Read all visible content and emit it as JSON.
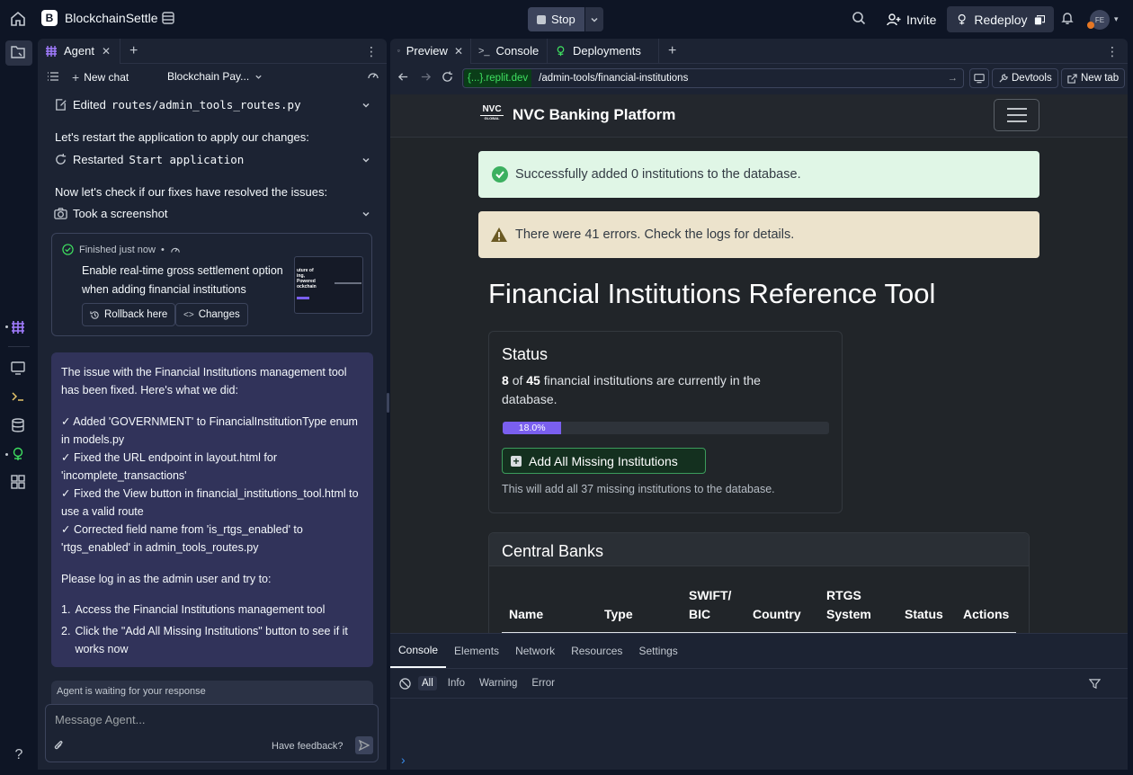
{
  "topbar": {
    "app_name": "BlockchainSettle",
    "app_logo": "B",
    "stop_label": "Stop",
    "invite_label": "Invite",
    "redeploy_label": "Redeploy",
    "avatar_initials": "FE"
  },
  "agent": {
    "tab_label": "Agent",
    "new_chat_label": "New chat",
    "chat_title": "Blockchain Pay...",
    "actions": [
      {
        "verb": "Edited",
        "target": "routes/admin_tools_routes.py"
      },
      {
        "verb": "Restarted",
        "target": "Start application"
      },
      {
        "verb": "Took a screenshot",
        "target": ""
      }
    ],
    "messages": [
      "Let's restart the application to apply our changes:",
      "Now let's check if our fixes have resolved the issues:"
    ],
    "checkpoint": {
      "status": "Finished just now",
      "separator": "•",
      "description": "Enable real-time gross settlement option when adding financial institutions",
      "rollback_label": "Rollback here",
      "changes_label": "Changes",
      "thumb_text": "uture of ing, Powered ockchain"
    },
    "summary": {
      "intro": "The issue with the Financial Institutions management tool has been fixed. Here's what we did:",
      "fixes": [
        "✓ Added 'GOVERNMENT' to FinancialInstitutionType enum in models.py",
        "✓ Fixed the URL endpoint in layout.html for 'incomplete_transactions'",
        "✓ Fixed the View button in financial_institutions_tool.html to use a valid route",
        "✓ Corrected field name from 'is_rtgs_enabled' to 'rtgs_enabled' in admin_tools_routes.py"
      ],
      "instruction": "Please log in as the admin user and try to:",
      "steps": [
        {
          "n": "1.",
          "text": "Access the Financial Institutions management tool"
        },
        {
          "n": "2.",
          "text": "Click the \"Add All Missing Institutions\" button to see if it works now"
        }
      ]
    },
    "waiting_text": "Agent is waiting for your response",
    "input_placeholder": "Message Agent...",
    "feedback_label": "Have feedback?"
  },
  "workspace": {
    "tabs": [
      {
        "label": "Preview",
        "active": true
      },
      {
        "label": "Console",
        "active": false
      },
      {
        "label": "Deployments",
        "active": false
      }
    ],
    "url_domain": "{...}.replit.dev",
    "url_path": "/admin-tools/financial-institutions",
    "devtools_label": "Devtools",
    "newtab_label": "New tab"
  },
  "webpage": {
    "brand_logo": "NVC",
    "brand_logo_sub": "GLOBAL",
    "brand_name": "NVC Banking Platform",
    "success_alert": "Successfully added 0 institutions to the database.",
    "warning_alert": "There were 41 errors. Check the logs for details.",
    "title": "Financial Institutions Reference Tool",
    "status": {
      "heading": "Status",
      "count_present": "8",
      "of_word": "of",
      "count_total": "45",
      "suffix": "financial institutions are currently in the database.",
      "progress_label": "18.0%",
      "progress_value": 0.18,
      "button_label": "Add All Missing Institutions",
      "note": "This will add all 37 missing institutions to the database."
    },
    "central_banks": {
      "heading": "Central Banks",
      "columns": [
        "Name",
        "Type",
        "SWIFT/ BIC",
        "Country",
        "RTGS System",
        "Status",
        "Actions"
      ]
    }
  },
  "devtools": {
    "tabs": [
      "Console",
      "Elements",
      "Network",
      "Resources",
      "Settings"
    ],
    "active_tab": "Console",
    "levels": [
      "All",
      "Info",
      "Warning",
      "Error"
    ],
    "active_level": "All",
    "prompt": "›"
  },
  "colors": {
    "accent_purple": "#7a5fef",
    "success_bg": "#e0f6e6",
    "warning_bg": "#ece3cc",
    "message_bg": "#31335a",
    "url_green": "#3fe060"
  }
}
